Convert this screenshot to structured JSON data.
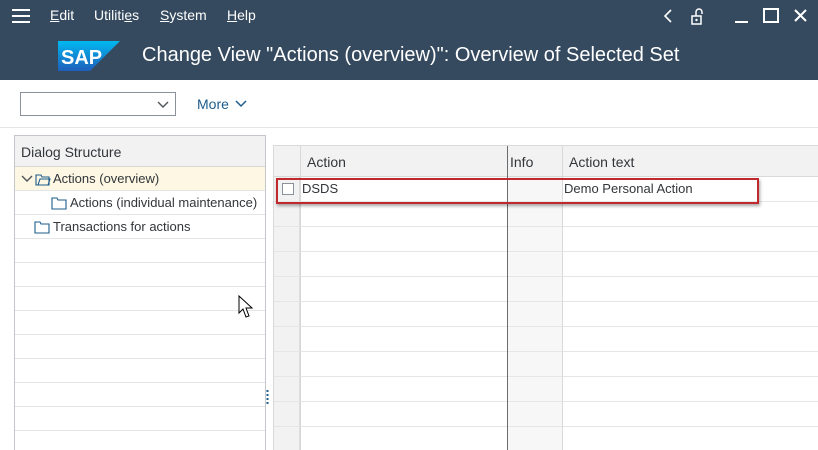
{
  "menu": {
    "edit": {
      "first": "E",
      "rest": "dit"
    },
    "utilities": {
      "first": "Utiliti",
      "u": "e",
      "rest": "s"
    },
    "system": {
      "first": "S",
      "rest": "ystem"
    },
    "help": {
      "first": "H",
      "rest": "elp"
    }
  },
  "window_controls": [
    "back-icon",
    "lock-icon",
    "minimize-icon",
    "maximize-icon",
    "close-icon"
  ],
  "logo_text": "SAP",
  "title": "Change View \"Actions (overview)\": Overview of Selected Set",
  "toolbar": {
    "dropdown_value": "",
    "more_label": "More"
  },
  "dialog_structure": {
    "header": "Dialog Structure",
    "items": [
      {
        "label": "Actions (overview)",
        "level": 0,
        "expanded": true,
        "selected": true
      },
      {
        "label": "Actions (individual maintenance)",
        "level": 1,
        "expanded": false,
        "selected": false
      },
      {
        "label": "Transactions for actions",
        "level": 0,
        "expanded": false,
        "selected": false
      }
    ]
  },
  "table": {
    "columns": [
      "Action",
      "Info",
      "Action text"
    ],
    "rows": [
      {
        "action": "DSDS",
        "info": "",
        "action_text": "Demo Personal Action",
        "checked": false
      }
    ]
  },
  "colors": {
    "shell": "#354a5f",
    "highlight": "#c0282d",
    "selected_row": "#fdf7e3",
    "link": "#0a6ed1"
  }
}
